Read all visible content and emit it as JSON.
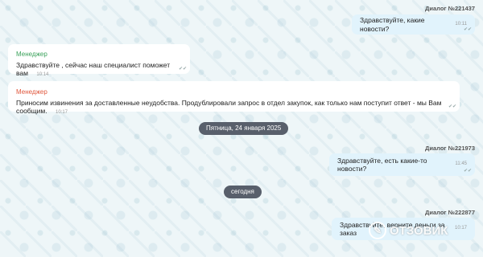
{
  "dialogs": [
    {
      "id_label": "Диалог №221437"
    },
    {
      "id_label": "Диалог №221973"
    },
    {
      "id_label": "Диалог №222877"
    }
  ],
  "messages": [
    {
      "text": "Здравствуйте, какие новости?",
      "time": "10:11"
    },
    {
      "sender": "Менеджер",
      "sender_color": "#3aa15a",
      "text": "Здравствуйте , сейчас наш специалист поможет вам",
      "time": "10:14"
    },
    {
      "sender": "Менеджер",
      "sender_color": "#e0573d",
      "text": "Приносим извинения за доставленные неудобства. Продублировали запрос в отдел закупок, как только нам поступит ответ - мы Вам сообщим.",
      "time": "10:17"
    },
    {
      "text": "Здравствуйте, есть какие-то новости?",
      "time": "11:45"
    },
    {
      "text": "Здравствуйте, верните деньги за заказ",
      "time": "10:17"
    }
  ],
  "date_separators": {
    "friday": "Пятница, 24 января 2025",
    "today": "сегодня"
  },
  "watermark": {
    "text": "ОТЗОВИК",
    "icon": "otzovik-logo-icon"
  }
}
